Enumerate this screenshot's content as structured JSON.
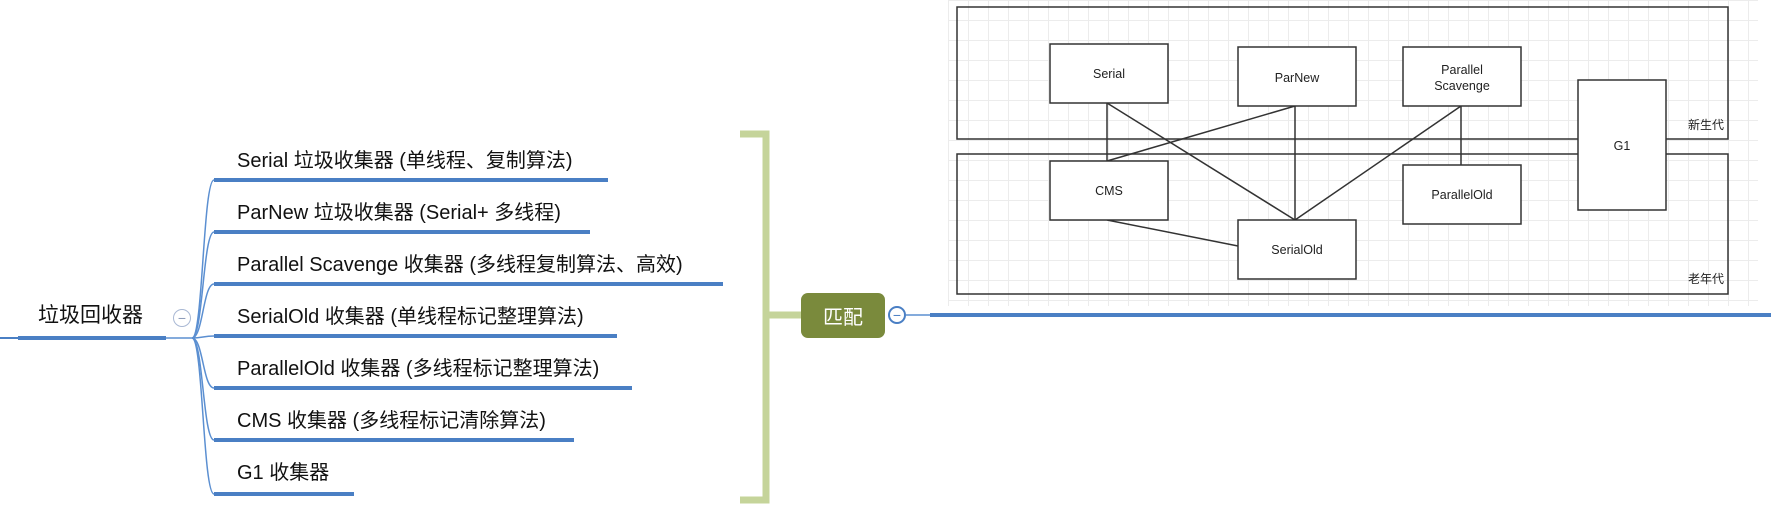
{
  "mindmap": {
    "root": {
      "label": "垃圾回收器"
    },
    "branches": [
      {
        "label": "Serial 垃圾收集器 (单线程、复制算法)"
      },
      {
        "label": "ParNew 垃圾收集器 (Serial+ 多线程)"
      },
      {
        "label": "Parallel Scavenge 收集器 (多线程复制算法、高效)"
      },
      {
        "label": "SerialOld 收集器 (单线程标记整理算法)"
      },
      {
        "label": "ParallelOld 收集器 (多线程标记整理算法)"
      },
      {
        "label": "CMS 收集器 (多线程标记清除算法)"
      },
      {
        "label": "G1 收集器"
      }
    ],
    "match_node": {
      "label": "匹配"
    },
    "toggle_symbol": "−"
  },
  "diagram": {
    "regions": {
      "young": "新生代",
      "old": "老年代"
    },
    "boxes": {
      "serial": "Serial",
      "parnew": "ParNew",
      "parallel_scavenge_line1": "Parallel",
      "parallel_scavenge_line2": "Scavenge",
      "g1": "G1",
      "cms": "CMS",
      "parallel_old": "ParallelOld",
      "serial_old": "SerialOld"
    }
  },
  "colors": {
    "branch_line": "#5b8fd1",
    "underline": "#4a7fc4",
    "bracket": "#c5d49a",
    "match_node_bg": "#7a8a3c"
  }
}
